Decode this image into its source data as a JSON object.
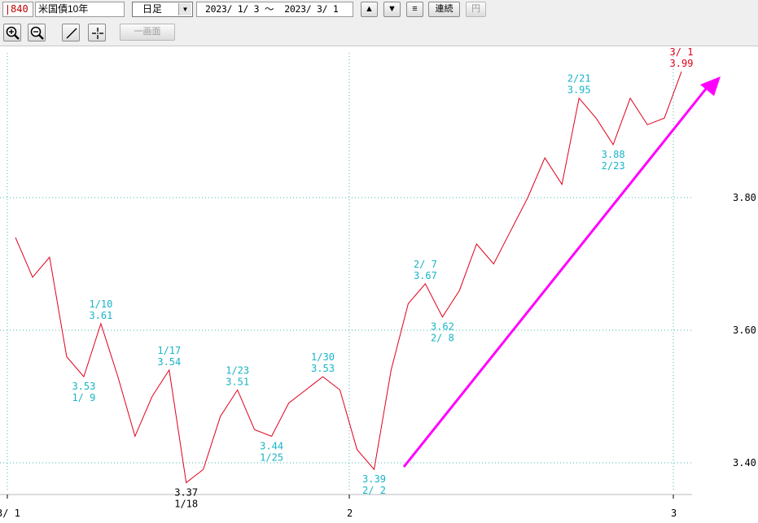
{
  "toolbar": {
    "code": "840",
    "name": "米国債10年",
    "period": "日足",
    "date_range": "2023/ 1/ 3 ～  2023/ 3/ 1",
    "up_label": "▲",
    "down_label": "▼",
    "list_label": "≡",
    "renzoku_label": "連続",
    "yen_label": "円",
    "single_screen_label": "一画面"
  },
  "colors": {
    "line": "#e0001b",
    "label_cyan": "#17b4c8",
    "label_black": "#000000",
    "arrow": "#ff00ff",
    "grid": "#45b9b0",
    "latest_label": "#e0001b"
  },
  "chart_data": {
    "type": "line",
    "y_ticks": [
      "3.40",
      "3.60",
      "3.80"
    ],
    "y_tick_values": [
      3.4,
      3.6,
      3.8
    ],
    "x_ticks": [
      "3/ 1",
      "2",
      "3"
    ],
    "values": [
      3.74,
      3.68,
      3.71,
      3.56,
      3.53,
      3.61,
      3.53,
      3.44,
      3.5,
      3.54,
      3.37,
      3.39,
      3.47,
      3.51,
      3.45,
      3.44,
      3.49,
      3.51,
      3.53,
      3.51,
      3.42,
      3.39,
      3.54,
      3.64,
      3.67,
      3.62,
      3.66,
      3.73,
      3.7,
      3.75,
      3.8,
      3.86,
      3.82,
      3.95,
      3.92,
      3.88,
      3.95,
      3.91,
      3.92,
      3.99
    ],
    "annotations": [
      {
        "index": 4,
        "value": "3.53",
        "date": "1/ 9",
        "pos": "below"
      },
      {
        "index": 5,
        "value": "3.61",
        "date": "1/10",
        "pos": "above"
      },
      {
        "index": 9,
        "value": "3.54",
        "date": "1/17",
        "pos": "above"
      },
      {
        "index": 10,
        "value": "3.37",
        "date": "1/18",
        "pos": "below"
      },
      {
        "index": 13,
        "value": "3.51",
        "date": "1/23",
        "pos": "above"
      },
      {
        "index": 15,
        "value": "3.44",
        "date": "1/25",
        "pos": "below"
      },
      {
        "index": 18,
        "value": "3.53",
        "date": "1/30",
        "pos": "above"
      },
      {
        "index": 21,
        "value": "3.39",
        "date": "2/ 2",
        "pos": "below"
      },
      {
        "index": 24,
        "value": "3.67",
        "date": "2/ 7",
        "pos": "above"
      },
      {
        "index": 25,
        "value": "3.62",
        "date": "2/ 8",
        "pos": "below"
      },
      {
        "index": 33,
        "value": "3.95",
        "date": "2/21",
        "pos": "above"
      },
      {
        "index": 35,
        "value": "3.88",
        "date": "2/23",
        "pos": "below"
      },
      {
        "index": 39,
        "value": "3.99",
        "date": "3/ 1",
        "pos": "above"
      }
    ]
  }
}
